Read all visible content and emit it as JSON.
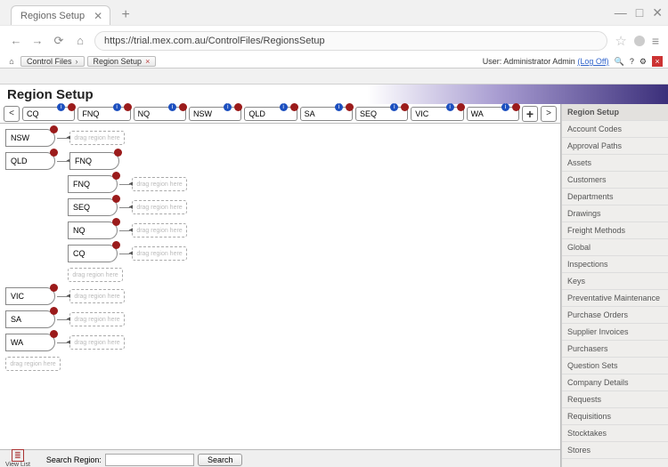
{
  "browser": {
    "tab_title": "Regions Setup",
    "url": "https://trial.mex.com.au/ControlFiles/RegionsSetup"
  },
  "breadcrumb": {
    "items": [
      "Control Files",
      "Region Setup"
    ]
  },
  "user_info": {
    "prefix": "User: ",
    "name": "Administrator Admin",
    "logoff": "(Log Off)"
  },
  "page_title": "Region Setup",
  "region_tabs": [
    "CQ",
    "FNQ",
    "NQ",
    "NSW",
    "QLD",
    "SA",
    "SEQ",
    "VIC",
    "WA"
  ],
  "tree": {
    "top": [
      "NSW"
    ],
    "qld": {
      "label": "QLD",
      "children": [
        "FNQ",
        "SEQ",
        "NQ",
        "CQ"
      ]
    },
    "bottom": [
      "VIC",
      "SA",
      "WA"
    ]
  },
  "drop_label": "drag region here",
  "sidebar": {
    "items": [
      "Region Setup",
      "Account Codes",
      "Approval Paths",
      "Assets",
      "Customers",
      "Departments",
      "Drawings",
      "Freight Methods",
      "Global",
      "Inspections",
      "Keys",
      "Preventative Maintenance",
      "Purchase Orders",
      "Supplier Invoices",
      "Purchasers",
      "Question Sets",
      "Company Details",
      "Requests",
      "Requisitions",
      "Stocktakes",
      "Stores"
    ]
  },
  "footer": {
    "view_list": "View List",
    "search_label": "Search Region:",
    "search_button": "Search"
  },
  "chart_data": {
    "type": "table",
    "title": "Region hierarchy",
    "regions_flat": [
      "CQ",
      "FNQ",
      "NQ",
      "NSW",
      "QLD",
      "SA",
      "SEQ",
      "VIC",
      "WA"
    ],
    "hierarchy": {
      "NSW": [],
      "QLD": [
        "FNQ",
        "SEQ",
        "NQ",
        "CQ"
      ],
      "VIC": [],
      "SA": [],
      "WA": []
    }
  }
}
